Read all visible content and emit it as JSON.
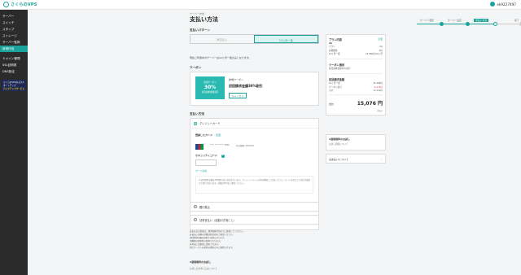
{
  "header": {
    "logo": "さくらのVPS",
    "user_id": "ek9227497"
  },
  "sidebar": {
    "items": [
      "サーバー",
      "スイッチ",
      "スタップ",
      "ストレージ",
      "サーバー監視",
      "新規作成"
    ],
    "items2": [
      "ドメイン管理",
      "SSL証明書",
      "DNS設定"
    ],
    "banner_line1": "さくらのVPSおよびスタートアップ",
    "banner_line2": "パックアップサービス"
  },
  "page": {
    "breadcrumb": "サーバー作成",
    "title": "支払い方法"
  },
  "steps": [
    "サーバー選択",
    "サーバー設定",
    "支払い方法",
    "完了"
  ],
  "payment_pattern": {
    "heading": "支払いパターン",
    "tab1": "毎月払い",
    "tab2": "12ヶ月一括",
    "note": "現在ご利用中のサーバーは12ヶ月一括のみとなります。"
  },
  "coupon": {
    "heading": "クーポン",
    "img_label": "新規クーポン",
    "img_big": "30%",
    "img_small": "初回請求金額割引",
    "title": "新規クーポン",
    "desc": "初回請求金額30%割引",
    "cancel": "キャンセル"
  },
  "payment_method": {
    "heading": "支払い方法",
    "credit": "クレジットカード",
    "registered_label": "登録したカード",
    "change": "変更",
    "card_number": "**** **** **** 3560",
    "expiry": "有効期限: 08/2025",
    "cvc_label": "セキュリティコード",
    "cvc_help": "?",
    "cvc_value": "",
    "add_card": "カード追加",
    "fine": "※ 初回請求金額は24時間以内に決済を行います。クレジットカードの有効期限にご注意ください。カード会社により決済が遅延する場合があります。詳細はFAQをご参照ください。",
    "bank": "銀行振込",
    "convenience": "請求書払い（自動引き落とし）"
  },
  "notes": [
    "支払方法の変更は、請求書発行前までに変更してください。",
    "お支払い金額の詳細は料金表をご確認ください。",
    "初回請求金額は日割り計算となります。",
    "消費税は請求時の税率となります。",
    "各月末に自動的に更新されます。",
    "割引クーポンは初回の請求のみに適用されます。"
  ],
  "sidebar_right": {
    "plan_heading": "プラン内容",
    "plan_change": "変更",
    "plan_name": "2G",
    "rows": [
      [
        "プラン",
        "2G"
      ],
      [
        "初期費用",
        "0円"
      ],
      [
        "12ヶ月一括",
        "21,588円/12ヶ月"
      ]
    ],
    "coupon_heading": "クーポン適用",
    "coupon_text": "初回請求金額30%割引",
    "first_heading": "初回請求金額",
    "breakdown": [
      [
        "12ヶ月一括",
        "21,588円"
      ],
      [
        "クーポン割引",
        "-6,476円"
      ],
      [
        "小計",
        "15,112円"
      ]
    ],
    "total_label": "合計",
    "total_value": "15,076 円",
    "tax": "(税込)",
    "upgrade_heading": "2週間無料のお試し",
    "upgrade_sub": "お試し期間について",
    "disclaimer": "お支払いについて"
  },
  "bottom": {
    "heading": "2週間無料のお試し",
    "sub": "お試しのお申し込みについて"
  }
}
